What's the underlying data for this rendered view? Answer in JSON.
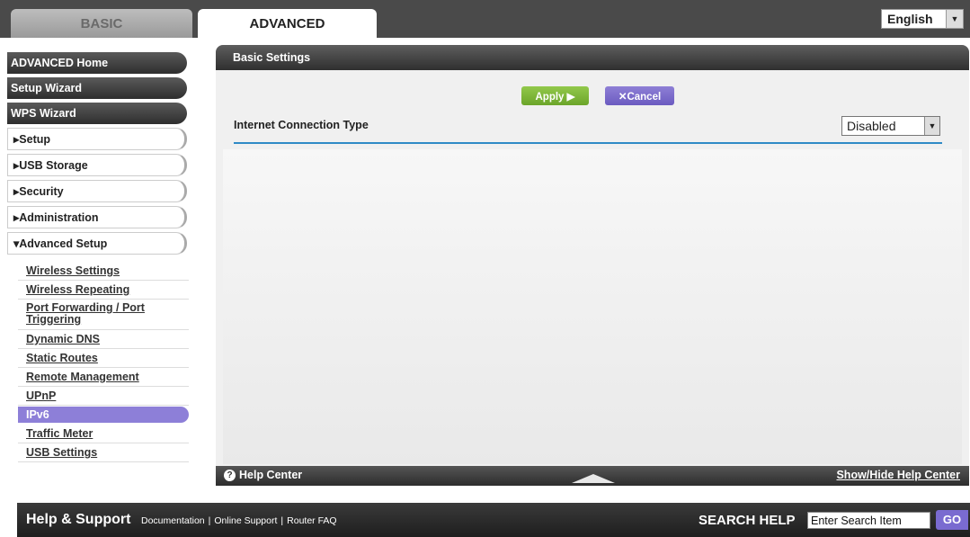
{
  "tabs": {
    "basic": "BASIC",
    "advanced": "ADVANCED"
  },
  "language": {
    "selected": "English"
  },
  "nav": {
    "items": [
      {
        "label": "ADVANCED Home"
      },
      {
        "label": "Setup Wizard"
      },
      {
        "label": "WPS Wizard"
      },
      {
        "label": "▸Setup"
      },
      {
        "label": "▸USB Storage"
      },
      {
        "label": "▸Security"
      },
      {
        "label": "▸Administration"
      },
      {
        "label": "▾Advanced Setup"
      }
    ],
    "sub_items": [
      {
        "label": "Wireless Settings"
      },
      {
        "label": "Wireless Repeating"
      },
      {
        "label": "Port Forwarding / Port Triggering"
      },
      {
        "label": "Dynamic DNS"
      },
      {
        "label": "Static Routes"
      },
      {
        "label": "Remote Management"
      },
      {
        "label": "UPnP"
      },
      {
        "label": "IPv6"
      },
      {
        "label": "Traffic Meter"
      },
      {
        "label": "USB Settings"
      }
    ]
  },
  "main": {
    "header": "Basic Settings",
    "apply_label": "Apply ▶",
    "cancel_label": "✕Cancel",
    "connection_type_label": "Internet Connection Type",
    "connection_type_value": "Disabled"
  },
  "help_center": {
    "label": "Help Center",
    "toggle_label": "Show/Hide Help Center"
  },
  "footer": {
    "title": "Help & Support",
    "links": [
      "Documentation",
      "Online Support",
      "Router FAQ"
    ],
    "search_label": "SEARCH HELP",
    "search_placeholder": "Enter Search Item",
    "go_label": "GO"
  },
  "colors": {
    "accent_purple": "#7a6bd0",
    "apply_green": "#7ab83a",
    "divider_blue": "#2f8ac6"
  }
}
